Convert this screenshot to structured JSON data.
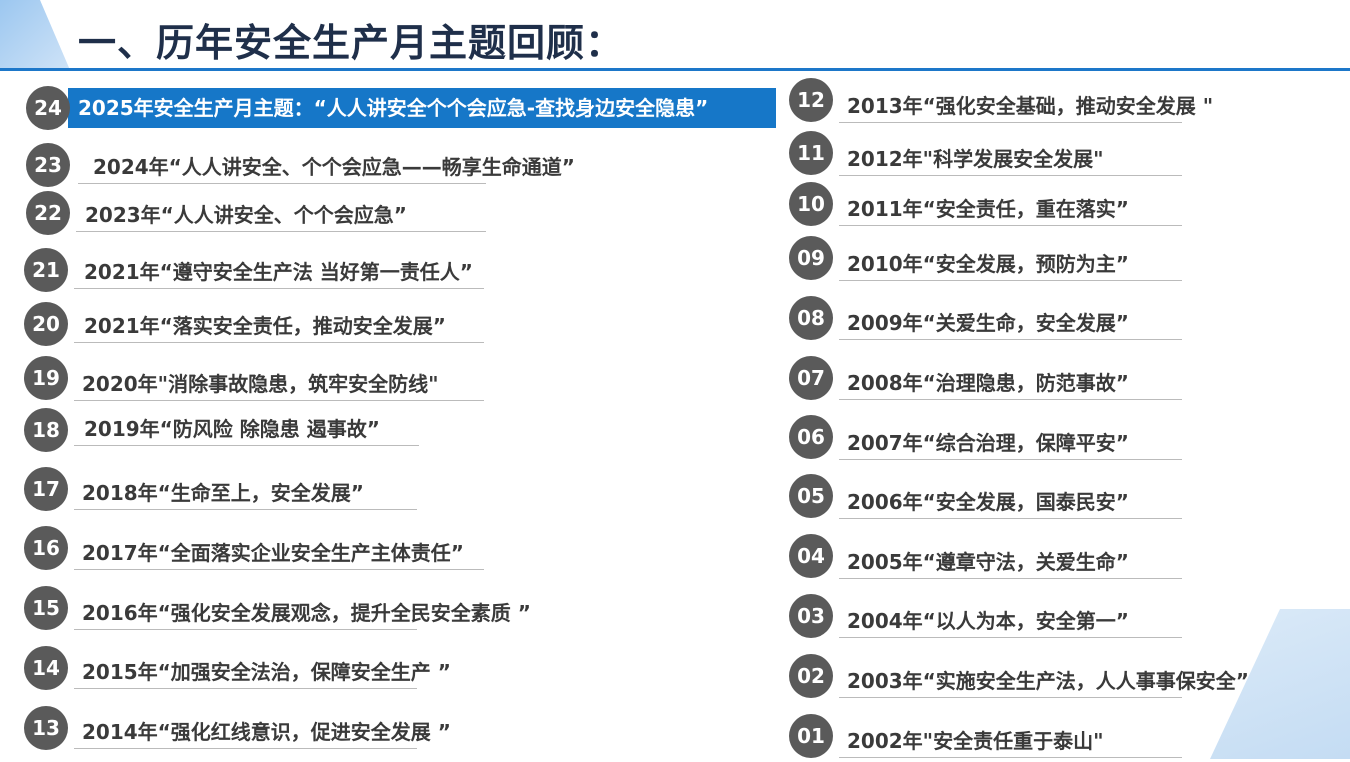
{
  "page_title": "一、历年安全生产月主题回顾：",
  "left_items": [
    {
      "num": "24",
      "text": "2025年安全生产月主题：“人人讲安全个个会应急-查找身边安全隐患”"
    },
    {
      "num": "23",
      "text": "2024年“人人讲安全、个个会应急——畅享生命通道”"
    },
    {
      "num": "22",
      "text": "2023年“人人讲安全、个个会应急”"
    },
    {
      "num": "21",
      "text": "2021年“遵守安全生产法 当好第一责任人”"
    },
    {
      "num": "20",
      "text": "2021年“落实安全责任，推动安全发展”"
    },
    {
      "num": "19",
      "text": "2020年\"消除事故隐患，筑牢安全防线\""
    },
    {
      "num": "18",
      "text": "2019年“防风险 除隐患 遏事故”"
    },
    {
      "num": "17",
      "text": "2018年“生命至上，安全发展”"
    },
    {
      "num": "16",
      "text": "2017年“全面落实企业安全生产主体责任”"
    },
    {
      "num": "15",
      "text": "2016年“强化安全发展观念，提升全民安全素质 ”"
    },
    {
      "num": "14",
      "text": "2015年“加强安全法治，保障安全生产 ”"
    },
    {
      "num": "13",
      "text": "2014年“强化红线意识，促进安全发展 ”"
    }
  ],
  "right_items": [
    {
      "num": "12",
      "text": "2013年“强化安全基础，推动安全发展 \""
    },
    {
      "num": "11",
      "text": "2012年\"科学发展安全发展\""
    },
    {
      "num": "10",
      "text": "2011年“安全责任，重在落实”"
    },
    {
      "num": "09",
      "text": "2010年“安全发展，预防为主”"
    },
    {
      "num": "08",
      "text": "2009年“关爱生命，安全发展”"
    },
    {
      "num": "07",
      "text": "2008年“治理隐患，防范事故”"
    },
    {
      "num": "06",
      "text": "2007年“综合治理，保障平安”"
    },
    {
      "num": "05",
      "text": "2006年“安全发展，国泰民安”"
    },
    {
      "num": "04",
      "text": "2005年“遵章守法，关爱生命”"
    },
    {
      "num": "03",
      "text": "2004年“以人为本，安全第一”"
    },
    {
      "num": "02",
      "text": "2003年“实施安全生产法，人人事事保安全”"
    },
    {
      "num": "01",
      "text": "2002年\"安全责任重于泰山\""
    }
  ],
  "colors": {
    "title": "#1f2f4a",
    "accent": "#1677c8",
    "badge": "#5a5a5a",
    "text": "#3a3a3a"
  }
}
